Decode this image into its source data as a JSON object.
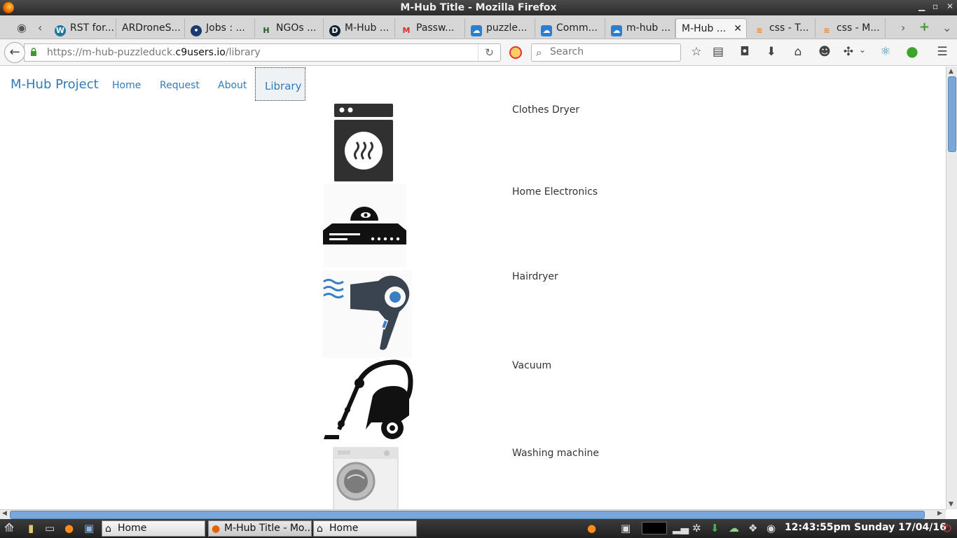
{
  "window": {
    "title": "M-Hub Title - Mozilla Firefox"
  },
  "tabs": [
    {
      "label": "RST for...",
      "icon": "wordpress-icon"
    },
    {
      "label": "ARDroneS...",
      "icon": "blank-page-icon"
    },
    {
      "label": "Jobs : ...",
      "icon": "jobs-icon"
    },
    {
      "label": "NGOs ...",
      "icon": "h-icon"
    },
    {
      "label": "M-Hub ...",
      "icon": "d-icon"
    },
    {
      "label": "Passw...",
      "icon": "gmail-icon"
    },
    {
      "label": "puzzle...",
      "icon": "cloud9-icon"
    },
    {
      "label": "Comm...",
      "icon": "cloud9-icon"
    },
    {
      "label": "m-hub ...",
      "icon": "cloud9-icon"
    },
    {
      "label": "M-Hub ...",
      "icon": "active",
      "active": true
    },
    {
      "label": "css - T...",
      "icon": "stackoverflow-icon"
    },
    {
      "label": "css - M...",
      "icon": "stackoverflow-icon"
    }
  ],
  "toolbar": {
    "url_prefix": "https://m-hub-puzzleduck.",
    "url_domain": "c9users.io",
    "url_path": "/library",
    "search_placeholder": "Search"
  },
  "site": {
    "brand": "M-Hub Project",
    "nav": [
      "Home",
      "Request",
      "About",
      "Library"
    ]
  },
  "library": [
    {
      "label": "Clothes Dryer",
      "icon": "clothes-dryer-icon"
    },
    {
      "label": "Home Electronics",
      "icon": "dvd-player-icon"
    },
    {
      "label": "Hairdryer",
      "icon": "hairdryer-icon"
    },
    {
      "label": "Vacuum",
      "icon": "vacuum-icon"
    },
    {
      "label": "Washing machine",
      "icon": "washing-machine-image"
    }
  ],
  "taskbar": {
    "tasks": [
      "Home",
      "M-Hub Title - Mo...",
      "Home"
    ],
    "clock": "12:43:55pm Sunday 17/04/16"
  },
  "colors": {
    "link": "#337ab7",
    "scroll_thumb": "#7aa7d9"
  }
}
